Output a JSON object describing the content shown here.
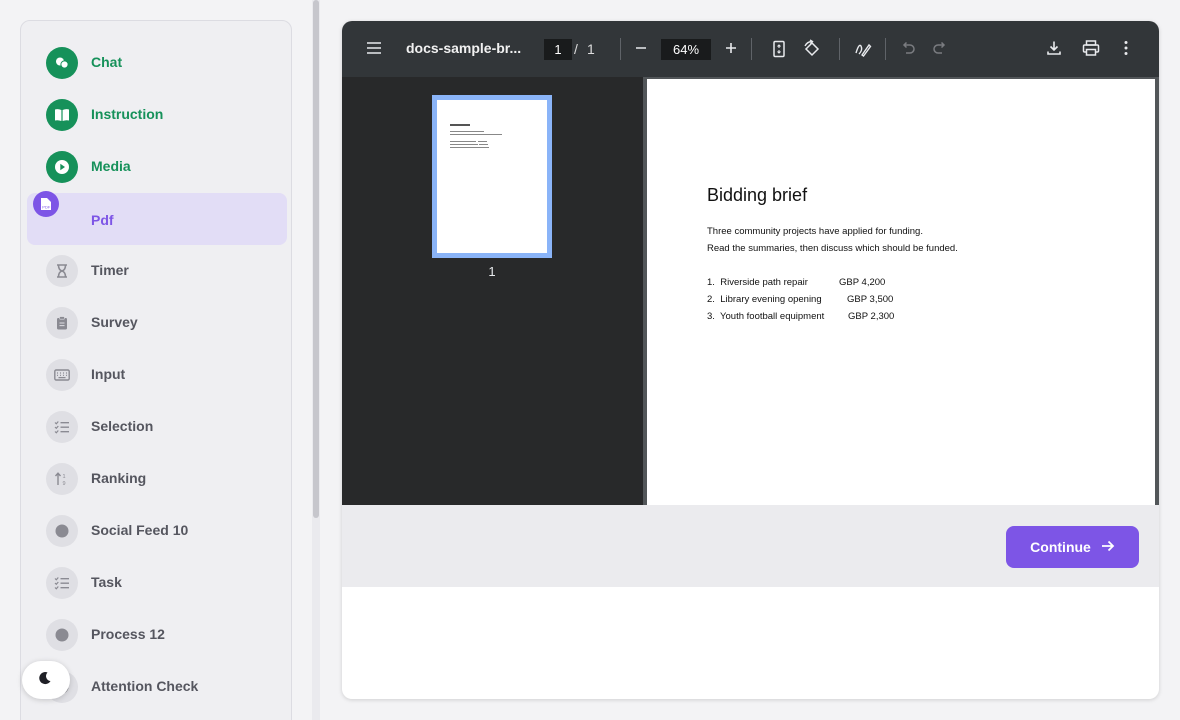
{
  "sidebar": {
    "items": [
      {
        "label": "Chat",
        "icon": "chat-icon",
        "state": "done"
      },
      {
        "label": "Instruction",
        "icon": "book-icon",
        "state": "done"
      },
      {
        "label": "Media",
        "icon": "play-icon",
        "state": "done"
      },
      {
        "label": "Pdf",
        "icon": "pdf-icon",
        "state": "active"
      },
      {
        "label": "Timer",
        "icon": "hourglass-icon",
        "state": "todo"
      },
      {
        "label": "Survey",
        "icon": "clipboard-icon",
        "state": "todo"
      },
      {
        "label": "Input",
        "icon": "keyboard-icon",
        "state": "todo"
      },
      {
        "label": "Selection",
        "icon": "checklist-icon",
        "state": "todo"
      },
      {
        "label": "Ranking",
        "icon": "sort-icon",
        "state": "todo"
      },
      {
        "label": "Social Feed 10",
        "icon": "dot-icon",
        "state": "todo"
      },
      {
        "label": "Task",
        "icon": "checklist-icon",
        "state": "todo"
      },
      {
        "label": "Process 12",
        "icon": "dot-icon",
        "state": "todo"
      },
      {
        "label": "Attention Check",
        "icon": "dot-icon",
        "state": "todo"
      }
    ]
  },
  "pdf_viewer": {
    "title": "docs-sample-br...",
    "page_current": "1",
    "page_separator": "/",
    "page_total": "1",
    "zoom": "64%",
    "thumbnail_label": "1"
  },
  "document": {
    "heading": "Bidding brief",
    "intro_line1": "Three community projects have applied for funding.",
    "intro_line2": "Read the summaries, then discuss which should be funded.",
    "projects": [
      {
        "num": "1.",
        "name": "Riverside path repair",
        "amount": "GBP 4,200"
      },
      {
        "num": "2.",
        "name": "Library evening opening",
        "amount": "GBP 3,500"
      },
      {
        "num": "3.",
        "name": "Youth football equipment",
        "amount": "GBP 2,300"
      }
    ]
  },
  "footer": {
    "continue_label": "Continue"
  },
  "colors": {
    "done": "#16915a",
    "active": "#7d55e6",
    "toolbar": "#323639"
  }
}
